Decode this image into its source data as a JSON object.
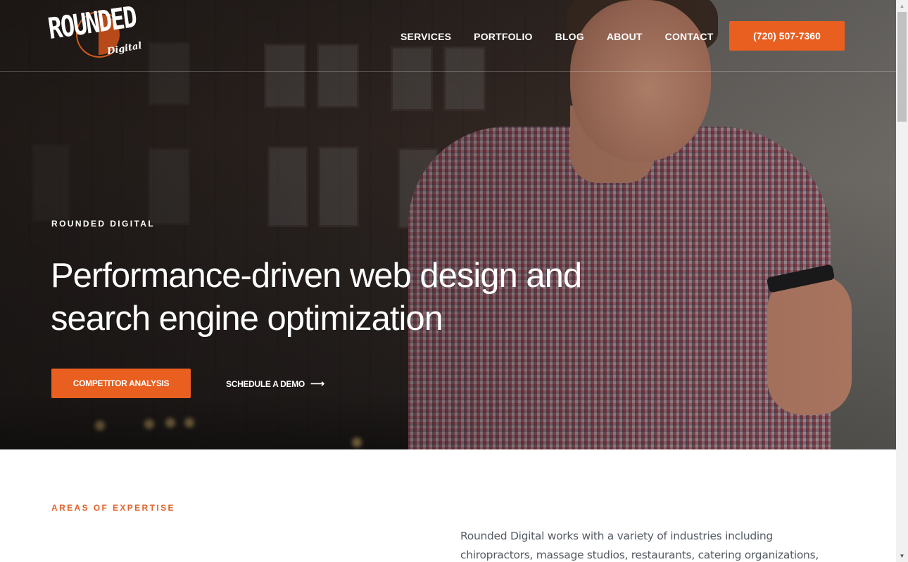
{
  "brand": {
    "logo_main": "ROUNDED",
    "logo_sub": "Digital",
    "accent_color": "#e85f20"
  },
  "nav": {
    "items": [
      {
        "label": "SERVICES"
      },
      {
        "label": "PORTFOLIO"
      },
      {
        "label": "BLOG"
      },
      {
        "label": "ABOUT"
      },
      {
        "label": "CONTACT"
      }
    ],
    "phone_label": "(720) 507-7360"
  },
  "hero": {
    "eyebrow": "ROUNDED DIGITAL",
    "headline": "Performance-driven web design and search engine optimization",
    "primary_cta": "COMPETITOR ANALYSIS",
    "secondary_cta": "SCHEDULE A DEMO",
    "secondary_cta_icon": "arrow-right-icon",
    "background_image": "man in plaid shirt looking at phone in front of brick building"
  },
  "expertise": {
    "label": "AREAS OF EXPERTISE",
    "body": "Rounded Digital works with a variety of industries including chiropractors, massage studios, restaurants, catering organizations,"
  },
  "scrollbar": {
    "up_icon": "▲",
    "down_icon": "▼"
  }
}
